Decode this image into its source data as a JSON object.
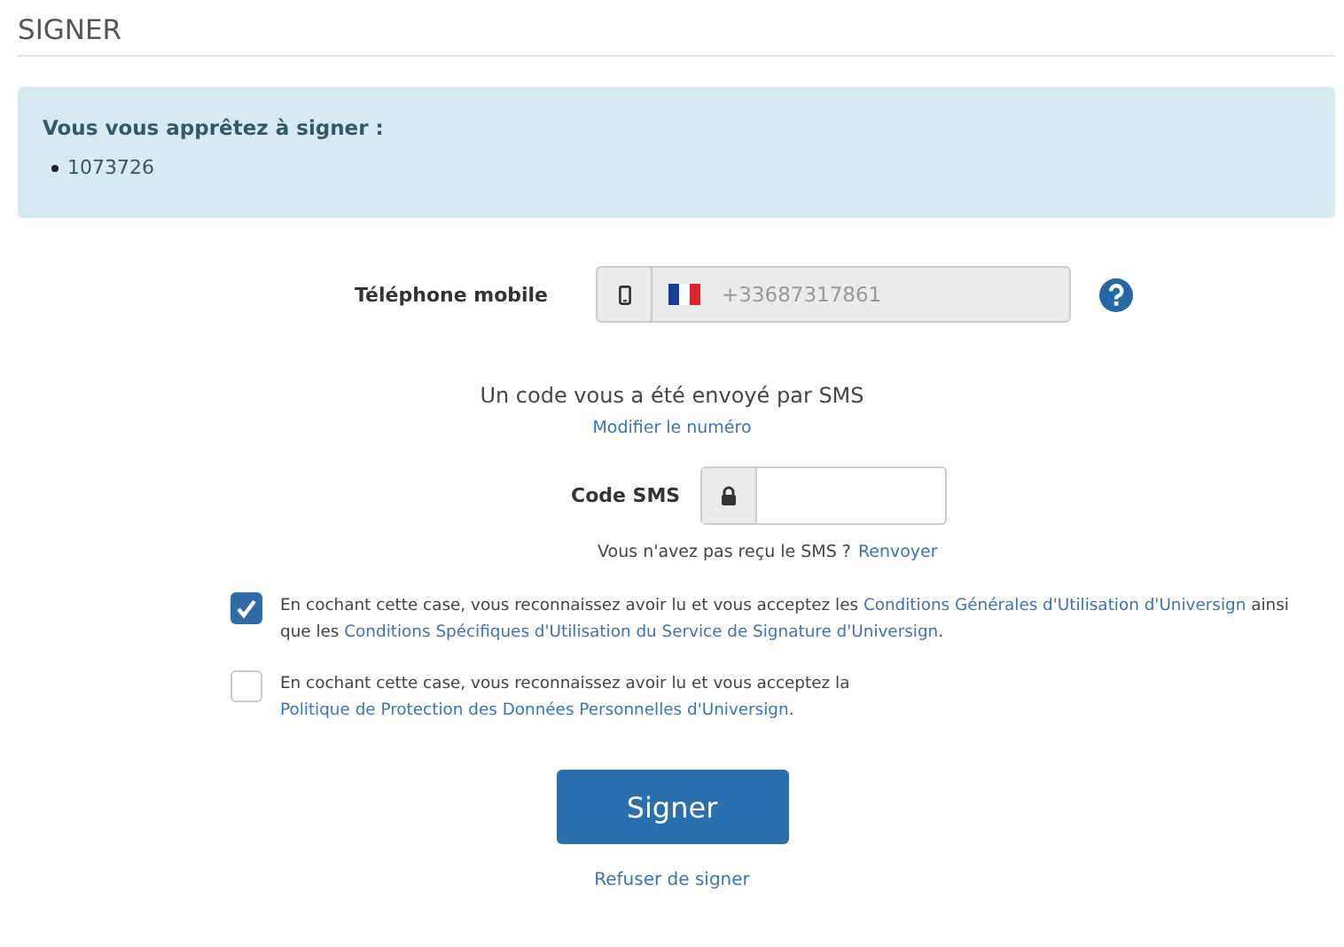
{
  "page_title": "SIGNER",
  "notice": {
    "heading": "Vous vous apprêtez à signer :",
    "items": [
      "1073726"
    ]
  },
  "phone": {
    "label": "Téléphone mobile",
    "value": "+33687317861",
    "disabled": true
  },
  "sms_info": {
    "message": "Un code vous a été envoyé par SMS",
    "change_link": "Modifier le numéro"
  },
  "sms_code": {
    "label": "Code SMS"
  },
  "resend": {
    "text": "Vous n'avez pas reçu le SMS ?",
    "link": "Renvoyer"
  },
  "consents": [
    {
      "checked": true,
      "parts": [
        {
          "kind": "text",
          "text": "En cochant cette case, vous reconnaissez avoir lu et vous acceptez les "
        },
        {
          "kind": "link",
          "text": "Conditions Générales d'Utilisation d'Universign"
        },
        {
          "kind": "text",
          "text": " ainsi que les "
        },
        {
          "kind": "link",
          "text": "Conditions Spécifiques d'Utilisation du Service de Signature d'Universign"
        },
        {
          "kind": "text",
          "text": "."
        }
      ]
    },
    {
      "checked": false,
      "parts": [
        {
          "kind": "text",
          "text": "En cochant cette case, vous reconnaissez avoir lu et vous acceptez la "
        },
        {
          "kind": "link",
          "text": "Politique de Protection des Données Personnelles d'Universign"
        },
        {
          "kind": "text",
          "text": "."
        }
      ]
    }
  ],
  "sign_button": "Signer",
  "refuse_link": "Refuser de signer"
}
